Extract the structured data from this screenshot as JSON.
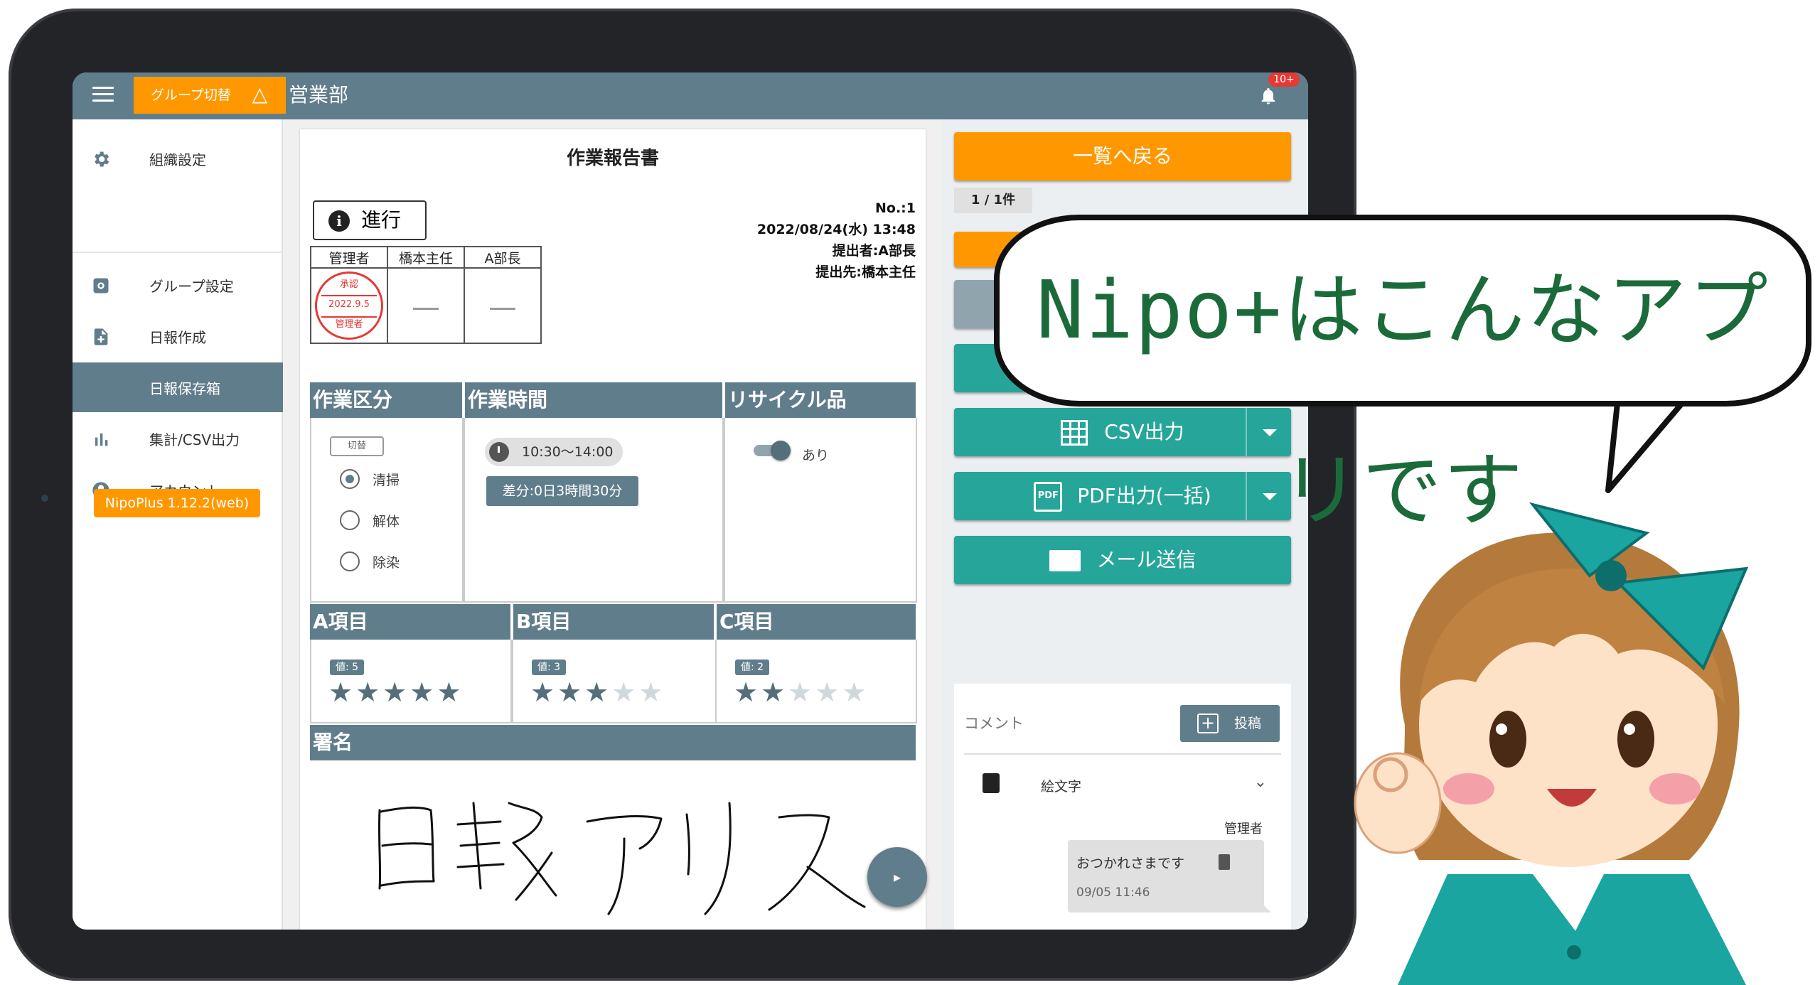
{
  "appbar": {
    "group_switch_label": "グループ切替",
    "department": "営業部",
    "notification_badge": "10+"
  },
  "sidebar": {
    "items": [
      {
        "label": "組織設定",
        "icon": "gear-icon"
      },
      {
        "label": "グループ設定",
        "icon": "gear-box-icon"
      },
      {
        "label": "日報作成",
        "icon": "file-add-icon"
      },
      {
        "label": "日報保存箱",
        "icon": "",
        "active": true
      },
      {
        "label": "集計/CSV出力",
        "icon": "bar-chart-icon"
      },
      {
        "label": "アカウント",
        "icon": "account-circle-icon"
      }
    ],
    "version": "NipoPlus 1.12.2(web)"
  },
  "report": {
    "title": "作業報告書",
    "status": "進行",
    "meta": {
      "no": "No.:1",
      "datetime": "2022/08/24(水) 13:48",
      "submitter": "提出者:A部長",
      "recipient": "提出先:橋本主任"
    },
    "approval": {
      "headers": [
        "管理者",
        "橋本主任",
        "A部長"
      ],
      "stamp": {
        "top": "承認",
        "date": "2022.9.5",
        "bottom": "管理者"
      }
    },
    "sections": {
      "work_type": {
        "title": "作業区分",
        "toggle_label": "切替",
        "options": [
          "清掃",
          "解体",
          "除染"
        ],
        "selected": "清掃"
      },
      "work_time": {
        "title": "作業時間",
        "time": "10:30〜14:00",
        "diff": "差分:0日3時間30分"
      },
      "recycle": {
        "title": "リサイクル品",
        "switch_label": "あり",
        "on": true
      },
      "ratings": [
        {
          "title": "A項目",
          "value_label": "値: 5",
          "value": 5,
          "max": 5
        },
        {
          "title": "B項目",
          "value_label": "値: 3",
          "value": 3,
          "max": 5
        },
        {
          "title": "C項目",
          "value_label": "値: 2",
          "value": 2,
          "max": 5
        }
      ],
      "signature": {
        "title": "署名",
        "handwriting": "日報アリス"
      }
    }
  },
  "right_panel": {
    "back_button": "一覧へ戻る",
    "pager": "1 / 1件",
    "csv_button": "CSV出力",
    "pdf_button": "PDF出力(一括)",
    "mail_button": "メール送信",
    "comments": {
      "title": "コメント",
      "post_button": "投稿",
      "emoji_label": "絵文字",
      "user": "管理者",
      "message": "おつかれさまです",
      "timestamp": "09/05 11:46"
    }
  },
  "speech_bubble": {
    "text": "Nipo+はこんなアプリです"
  },
  "colors": {
    "primary": "#607d8b",
    "accent": "#ff9800",
    "teal": "#26a69a",
    "stamp_red": "#e53935",
    "handwriting_green": "#1b6b3a"
  }
}
